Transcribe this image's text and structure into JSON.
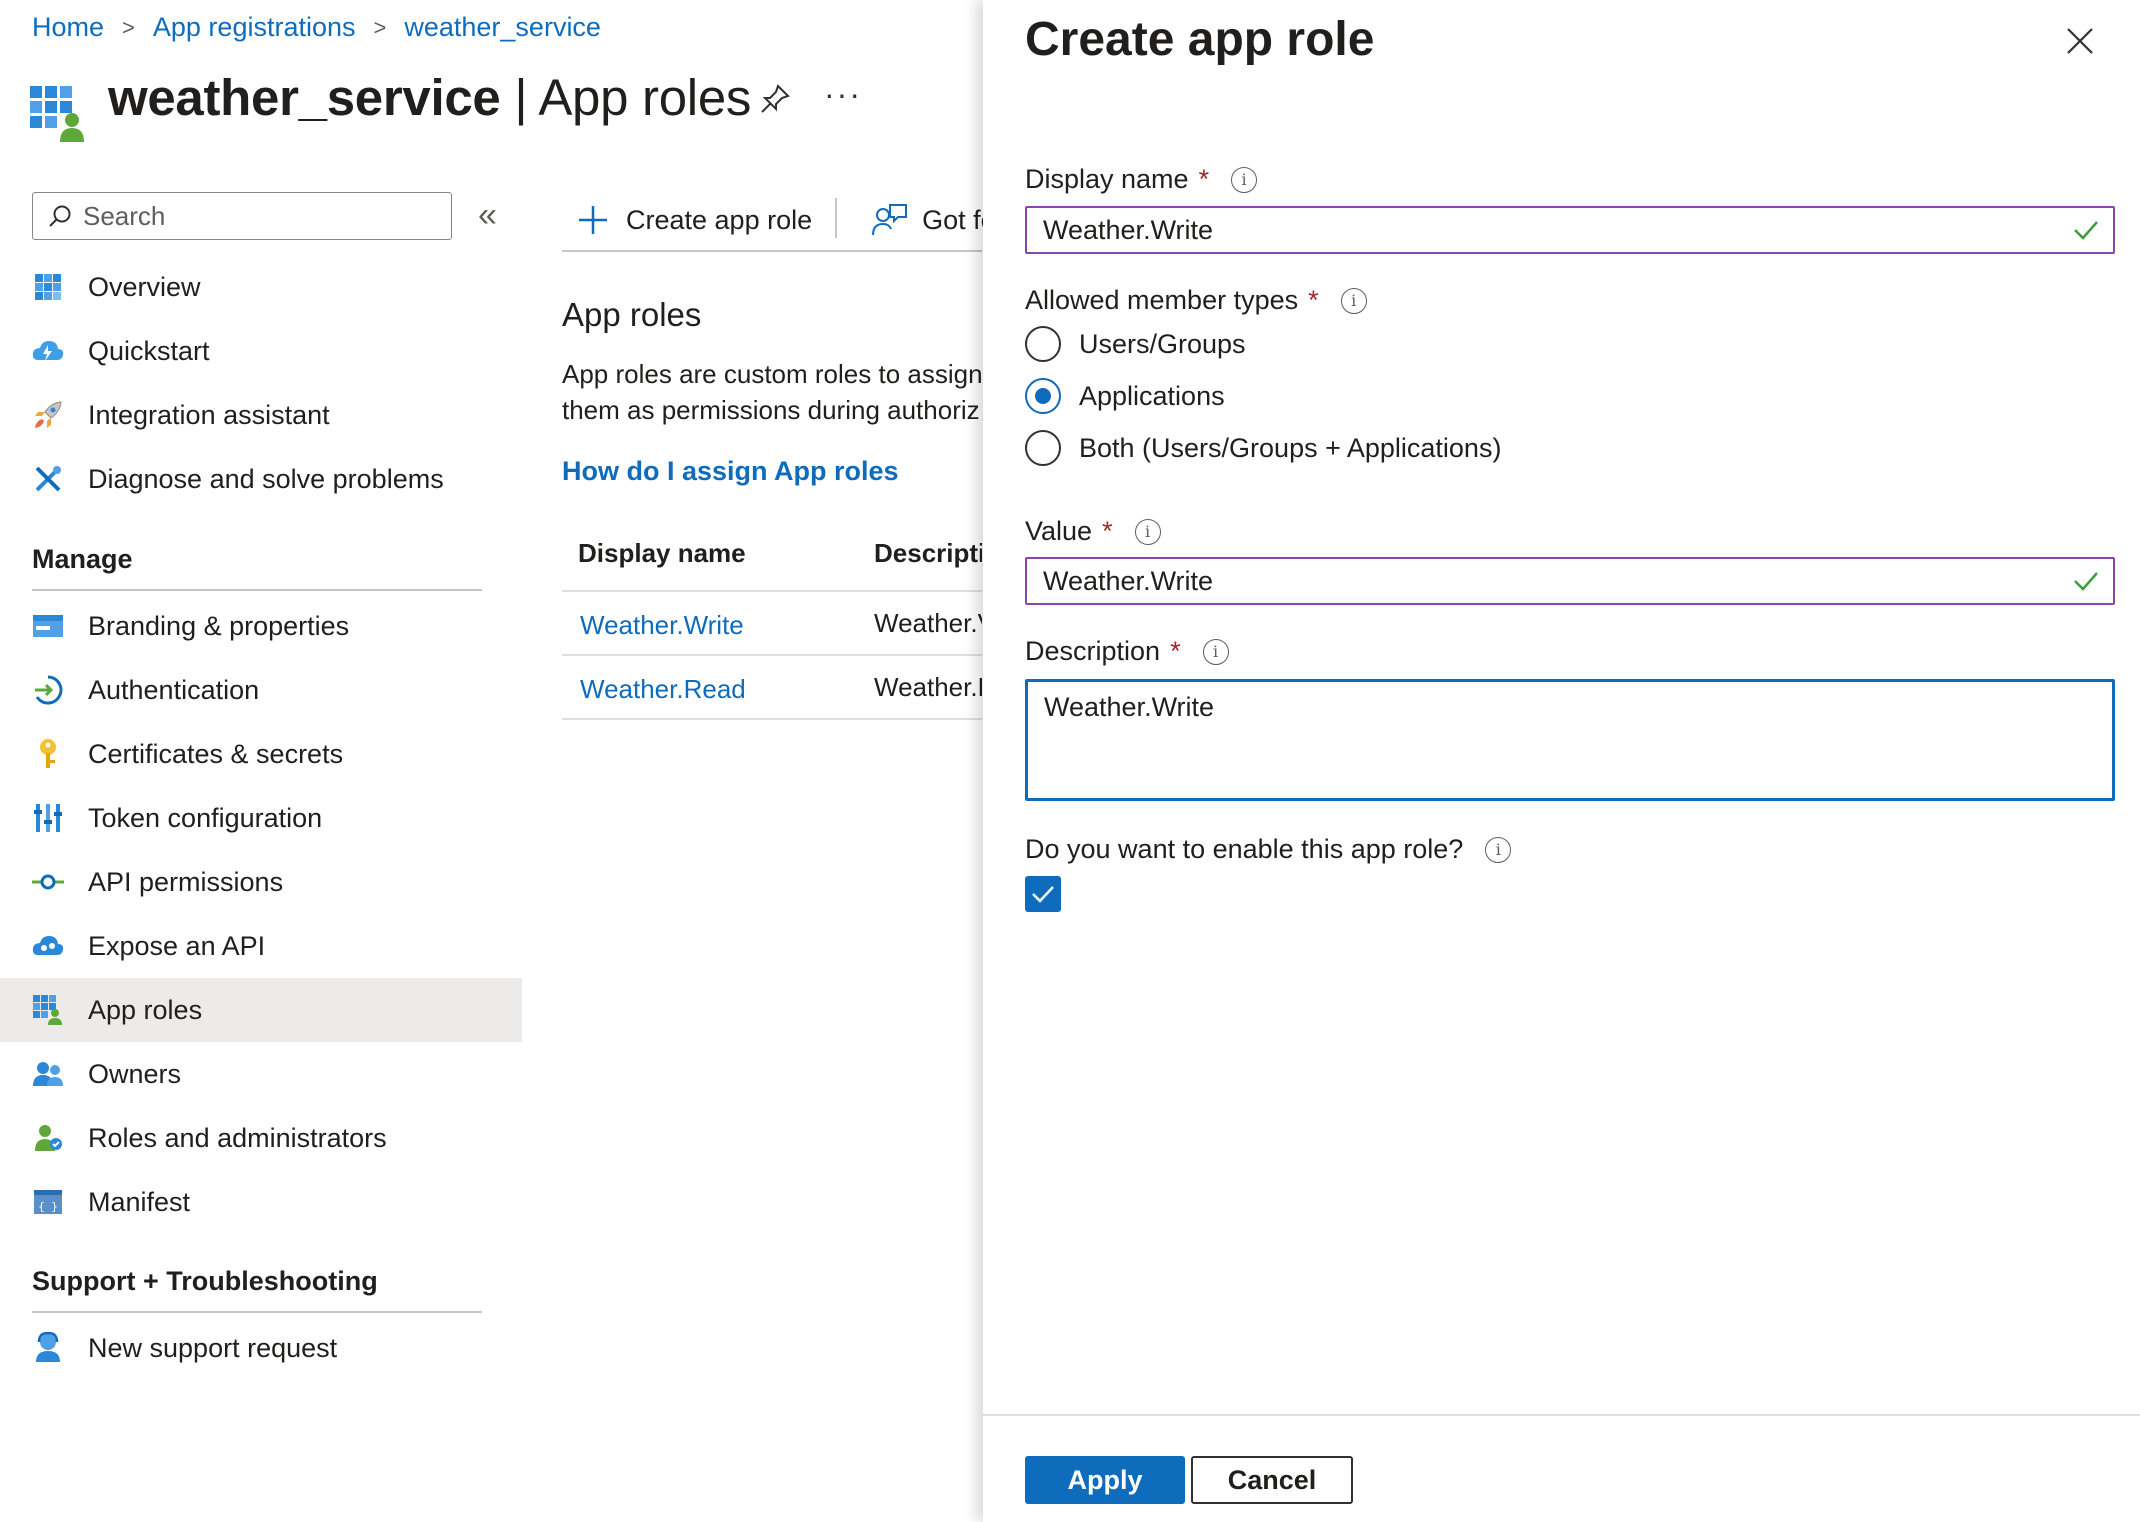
{
  "breadcrumb": [
    "Home",
    "App registrations",
    "weather_service"
  ],
  "page_title": {
    "bold": "weather_service",
    "rest": " | App roles"
  },
  "header_more": "···",
  "search": {
    "placeholder": "Search"
  },
  "collapse_label": "«",
  "nav": {
    "top_items": [
      {
        "label": "Overview",
        "icon": "overview-icon"
      },
      {
        "label": "Quickstart",
        "icon": "quickstart-icon"
      },
      {
        "label": "Integration assistant",
        "icon": "rocket-icon"
      },
      {
        "label": "Diagnose and solve problems",
        "icon": "tools-icon"
      }
    ],
    "manage_heading": "Manage",
    "manage_items": [
      {
        "label": "Branding & properties",
        "icon": "branding-icon"
      },
      {
        "label": "Authentication",
        "icon": "authentication-icon"
      },
      {
        "label": "Certificates & secrets",
        "icon": "key-icon"
      },
      {
        "label": "Token configuration",
        "icon": "token-icon"
      },
      {
        "label": "API permissions",
        "icon": "api-permissions-icon"
      },
      {
        "label": "Expose an API",
        "icon": "cloud-icon"
      },
      {
        "label": "App roles",
        "icon": "app-roles-icon",
        "active": true
      },
      {
        "label": "Owners",
        "icon": "owners-icon"
      },
      {
        "label": "Roles and administrators",
        "icon": "roles-admin-icon"
      },
      {
        "label": "Manifest",
        "icon": "manifest-icon"
      }
    ],
    "support_heading": "Support + Troubleshooting",
    "support_items": [
      {
        "label": "New support request",
        "icon": "support-icon"
      }
    ]
  },
  "toolbar": {
    "create_label": "Create app role",
    "feedback_label": "Got fe"
  },
  "main": {
    "heading": "App roles",
    "description_line1": "App roles are custom roles to assign",
    "description_line2": "them as permissions during authoriz",
    "howto_link": "How do I assign App roles",
    "table": {
      "headers": [
        "Display name",
        "Descriptic"
      ],
      "rows": [
        [
          "Weather.Write",
          "Weather.V"
        ],
        [
          "Weather.Read",
          "Weather.F"
        ]
      ]
    }
  },
  "panel": {
    "title": "Create app role",
    "display_name_label": "Display name",
    "display_name_value": "Weather.Write",
    "member_types_label": "Allowed member types",
    "member_options": [
      "Users/Groups",
      "Applications",
      "Both (Users/Groups + Applications)"
    ],
    "member_selected": "Applications",
    "value_label": "Value",
    "value_value": "Weather.Write",
    "description_label": "Description",
    "description_value": "Weather.Write",
    "enable_label": "Do you want to enable this app role?",
    "enable_checked": true,
    "apply_label": "Apply",
    "cancel_label": "Cancel",
    "required_mark": "*",
    "info_glyph": "i"
  },
  "colors": {
    "accent": "#0f6cbd",
    "required": "#a4262c",
    "valid_border": "#8e44ad",
    "valid_check": "#3aa13a"
  }
}
